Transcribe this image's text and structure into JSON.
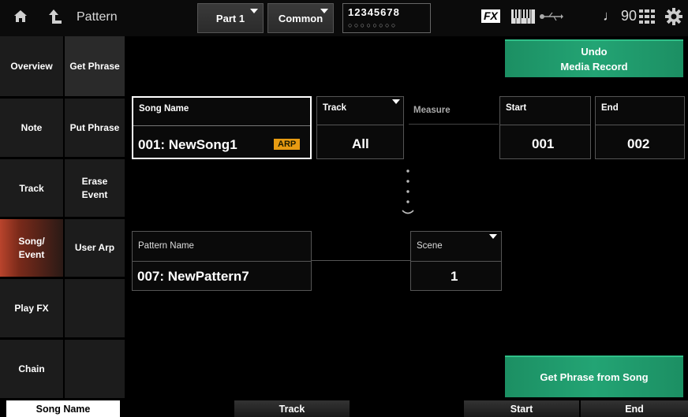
{
  "topbar": {
    "title": "Pattern",
    "part_btn": "Part 1",
    "common_btn": "Common",
    "part_numbers": "12345678",
    "part_dots": "○○○○○○○○",
    "fx_badge": "FX",
    "tempo": "♩ 90",
    "icons": [
      "home-icon",
      "back-arrow-icon",
      "keyboard-icon",
      "usb-icon",
      "grid-menu-icon",
      "gear-icon"
    ]
  },
  "left_tabs": [
    {
      "label": "Overview",
      "selected": false
    },
    {
      "label": "Note",
      "selected": false
    },
    {
      "label": "Track",
      "selected": false
    },
    {
      "label": "Song/\nEvent",
      "selected": true
    },
    {
      "label": "Play FX",
      "selected": false
    },
    {
      "label": "Chain",
      "selected": false
    }
  ],
  "sub_tabs": [
    {
      "label": "Get Phrase",
      "selected": true
    },
    {
      "label": "Put Phrase",
      "selected": false
    },
    {
      "label": "Erase\nEvent",
      "selected": false
    },
    {
      "label": "User Arp",
      "selected": false
    },
    {
      "label": "",
      "selected": false
    },
    {
      "label": "",
      "selected": false
    }
  ],
  "undo_button": {
    "line1": "Undo",
    "line2": "Media Record"
  },
  "song_name": {
    "label": "Song Name",
    "value": "001: NewSong1",
    "badge": "ARP"
  },
  "track": {
    "label": "Track",
    "value": "All"
  },
  "measure": {
    "label": "Measure"
  },
  "start": {
    "label": "Start",
    "value": "001"
  },
  "end": {
    "label": "End",
    "value": "002"
  },
  "pattern_name": {
    "label": "Pattern Name",
    "value": "007: NewPattern7"
  },
  "scene": {
    "label": "Scene",
    "value": "1"
  },
  "get_phrase_button": "Get Phrase from Song",
  "bottom_bar": {
    "song_name": "Song Name",
    "track": "Track",
    "start": "Start",
    "end": "End"
  }
}
